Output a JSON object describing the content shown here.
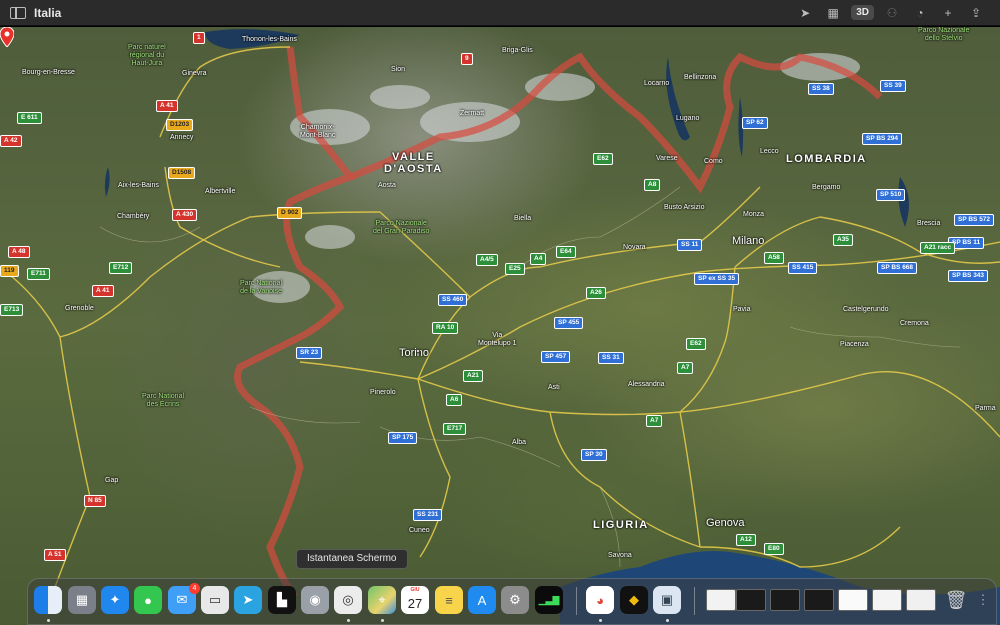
{
  "window": {
    "title": "Italia",
    "toolbar": {
      "mode_3d": "3D",
      "plus": "+",
      "share": "⇪"
    }
  },
  "map": {
    "regions": [
      {
        "id": "valle-daosta",
        "text": "VALLE\nD'AOSTA"
      },
      {
        "id": "lombardia",
        "text": "LOMBARDIA"
      },
      {
        "id": "liguria",
        "text": "LIGURIA"
      }
    ],
    "cities": [
      {
        "id": "torino",
        "text": "Torino"
      },
      {
        "id": "milano",
        "text": "Milano"
      },
      {
        "id": "genova",
        "text": "Genova"
      },
      {
        "id": "ginevra",
        "text": "Ginevra"
      },
      {
        "id": "thonon",
        "text": "Thonon-les-Bains"
      },
      {
        "id": "bourg",
        "text": "Bourg-en-Bresse"
      },
      {
        "id": "annecy",
        "text": "Annecy"
      },
      {
        "id": "aix",
        "text": "Aix-les-Bains"
      },
      {
        "id": "albertville",
        "text": "Albertville"
      },
      {
        "id": "chambery",
        "text": "Chambéry"
      },
      {
        "id": "grenoble",
        "text": "Grenoble"
      },
      {
        "id": "gap",
        "text": "Gap"
      },
      {
        "id": "sion",
        "text": "Sion"
      },
      {
        "id": "zermatt",
        "text": "Zermatt"
      },
      {
        "id": "chamonix",
        "text": "Chamonix-\nMont-Blanc"
      },
      {
        "id": "aosta",
        "text": "Aosta"
      },
      {
        "id": "biella",
        "text": "Biella"
      },
      {
        "id": "novara",
        "text": "Novara"
      },
      {
        "id": "briga",
        "text": "Briga-Glis"
      },
      {
        "id": "locarno",
        "text": "Locarno"
      },
      {
        "id": "bellinzona",
        "text": "Bellinzona"
      },
      {
        "id": "lugano",
        "text": "Lugano"
      },
      {
        "id": "varese",
        "text": "Varese"
      },
      {
        "id": "como",
        "text": "Como"
      },
      {
        "id": "lecco",
        "text": "Lecco"
      },
      {
        "id": "bergamo",
        "text": "Bergamo"
      },
      {
        "id": "brescia",
        "text": "Brescia"
      },
      {
        "id": "busto",
        "text": "Busto Arsizio"
      },
      {
        "id": "monza",
        "text": "Monza"
      },
      {
        "id": "pavia",
        "text": "Pavia"
      },
      {
        "id": "castelgerundo",
        "text": "Castelgerundo"
      },
      {
        "id": "cremona",
        "text": "Cremona"
      },
      {
        "id": "piacenza",
        "text": "Piacenza"
      },
      {
        "id": "parma",
        "text": "Parma"
      },
      {
        "id": "alessandria",
        "text": "Alessandria"
      },
      {
        "id": "asti",
        "text": "Asti"
      },
      {
        "id": "alba",
        "text": "Alba"
      },
      {
        "id": "pinerolo",
        "text": "Pinerolo"
      },
      {
        "id": "cuneo",
        "text": "Cuneo"
      },
      {
        "id": "savona",
        "text": "Savona"
      }
    ],
    "parks": [
      {
        "id": "haut-jura",
        "text": "Parc naturel\nrégional du\nHaut-Jura"
      },
      {
        "id": "gran-paradiso",
        "text": "Parco Nazionale\ndel Gran Paradiso"
      },
      {
        "id": "vanoise",
        "text": "Parc National\nde la Vanoise"
      },
      {
        "id": "ecrins",
        "text": "Parc National\ndes Écrins"
      },
      {
        "id": "stelvio",
        "text": "Parco Nazionale\ndello Stelvio"
      }
    ],
    "pin": {
      "text": "Via\nMontelupo 1"
    },
    "shields": [
      {
        "id": "s1",
        "text": "1"
      },
      {
        "id": "s9",
        "text": "9"
      },
      {
        "id": "a41a",
        "text": "A 41"
      },
      {
        "id": "e611",
        "text": "E 611"
      },
      {
        "id": "a42",
        "text": "A 42"
      },
      {
        "id": "d1203",
        "text": "D1203"
      },
      {
        "id": "d1508",
        "text": "D1508"
      },
      {
        "id": "a430",
        "text": "A 430"
      },
      {
        "id": "d902",
        "text": "D 902"
      },
      {
        "id": "a48",
        "text": "A 48"
      },
      {
        "id": "n19",
        "text": "119"
      },
      {
        "id": "e711",
        "text": "E711"
      },
      {
        "id": "e712",
        "text": "E712"
      },
      {
        "id": "a41b",
        "text": "A 41"
      },
      {
        "id": "e713",
        "text": "E713"
      },
      {
        "id": "n85",
        "text": "N 85"
      },
      {
        "id": "a51",
        "text": "A 51"
      },
      {
        "id": "ss38",
        "text": "SS 38"
      },
      {
        "id": "ss39",
        "text": "SS 39"
      },
      {
        "id": "sp62",
        "text": "SP 62"
      },
      {
        "id": "spbs294",
        "text": "SP BS 294"
      },
      {
        "id": "e62",
        "text": "E62"
      },
      {
        "id": "a8",
        "text": "A8"
      },
      {
        "id": "sp510",
        "text": "SP 510"
      },
      {
        "id": "spbs572",
        "text": "SP BS 572"
      },
      {
        "id": "ss11a",
        "text": "SS 11"
      },
      {
        "id": "a35",
        "text": "A35"
      },
      {
        "id": "spbs11",
        "text": "SP BS 11"
      },
      {
        "id": "a21r",
        "text": "A21 racc"
      },
      {
        "id": "spbs668",
        "text": "SP BS 668"
      },
      {
        "id": "spbs343",
        "text": "SP BS 343"
      },
      {
        "id": "a58",
        "text": "A58"
      },
      {
        "id": "ss415",
        "text": "SS 415"
      },
      {
        "id": "spexss35",
        "text": "SP ex SS 35"
      },
      {
        "id": "e64",
        "text": "E64"
      },
      {
        "id": "a4",
        "text": "A4"
      },
      {
        "id": "a45",
        "text": "A4/5"
      },
      {
        "id": "e25",
        "text": "E25"
      },
      {
        "id": "a26",
        "text": "A26"
      },
      {
        "id": "ss460",
        "text": "SS 460"
      },
      {
        "id": "ra10",
        "text": "RA 10"
      },
      {
        "id": "sp455",
        "text": "SP 455"
      },
      {
        "id": "sr23",
        "text": "SR 23"
      },
      {
        "id": "sp457",
        "text": "SP 457"
      },
      {
        "id": "ss31",
        "text": "SS 31"
      },
      {
        "id": "e62b",
        "text": "E62"
      },
      {
        "id": "a7a",
        "text": "A7"
      },
      {
        "id": "a21",
        "text": "A21"
      },
      {
        "id": "a6",
        "text": "A6"
      },
      {
        "id": "e717",
        "text": "E717"
      },
      {
        "id": "a7b",
        "text": "A7"
      },
      {
        "id": "sp175",
        "text": "SP 175"
      },
      {
        "id": "sp30",
        "text": "SP 30"
      },
      {
        "id": "ss231",
        "text": "SS 231"
      },
      {
        "id": "a12",
        "text": "A12"
      },
      {
        "id": "e80",
        "text": "E80"
      }
    ]
  },
  "tooltip": "Istantanea Schermo",
  "dock": {
    "mail_badge": "4",
    "calendar_month": "GIU",
    "calendar_day": "27"
  },
  "colors": {
    "accent": "#2f6fd6",
    "border": "#d94a3e",
    "pin": "#e8312a"
  }
}
